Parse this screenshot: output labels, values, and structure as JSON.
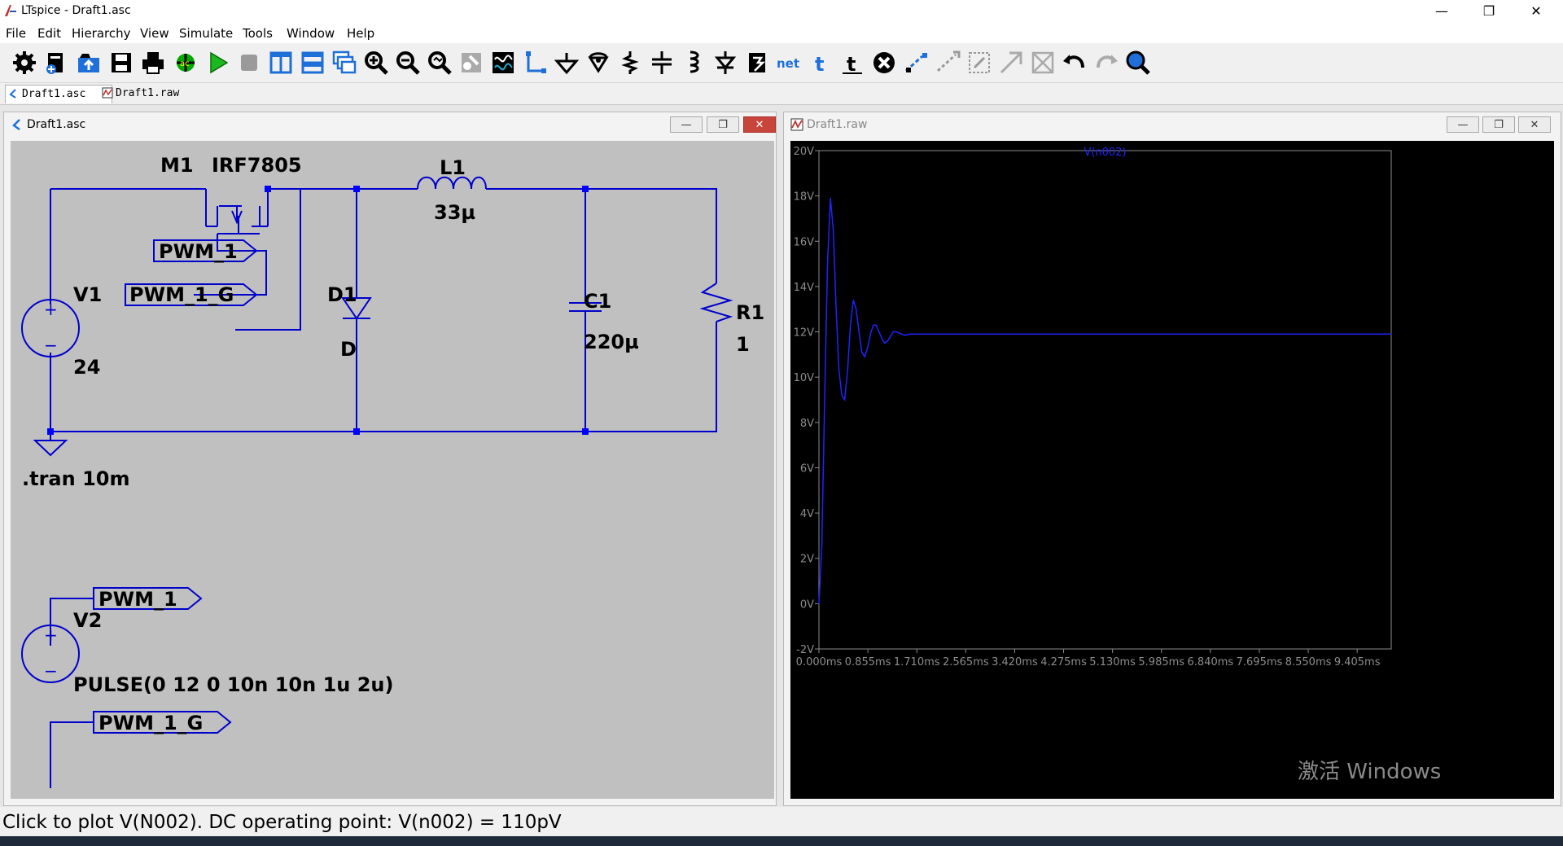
{
  "app": {
    "title": "LTspice - Draft1.asc",
    "window_controls": {
      "minimize": "—",
      "maximize": "❐",
      "close": "✕"
    }
  },
  "menu": [
    "File",
    "Edit",
    "Hierarchy",
    "View",
    "Simulate",
    "Tools",
    "Window",
    "Help"
  ],
  "toolbar": {
    "icons": [
      "settings-icon",
      "new-schematic-icon",
      "open-icon",
      "save-icon",
      "print-icon",
      "ac-analysis-icon",
      "run-icon",
      "halt-icon",
      "tile-vertical-icon",
      "tile-horizontal-icon",
      "cascade-icon",
      "zoom-in-icon",
      "zoom-out-icon",
      "zoom-fit-icon",
      "zoom-area-icon",
      "autoscale-icon",
      "wire-icon",
      "ground-icon",
      "label-net-icon",
      "resistor-icon",
      "capacitor-icon",
      "inductor-icon",
      "diode-icon",
      "component-icon",
      "spice-directive-icon",
      "text-icon",
      "move-icon",
      "delete-icon",
      "duplicate-icon",
      "drag-icon",
      "rotate-icon",
      "mirror-icon",
      "undo-icon",
      "redo-icon",
      "find-icon"
    ],
    "net_label": "net"
  },
  "tabs": [
    {
      "label": "Draft1.asc",
      "active": true
    },
    {
      "label": "Draft1.raw",
      "active": false
    }
  ],
  "schematic_window": {
    "title": "Draft1.asc",
    "labels": {
      "m1": "M1",
      "m1_model": "IRF7805",
      "l1": "L1",
      "l1_value": "33µ",
      "v1": "V1",
      "v1_value": "24",
      "d1": "D1",
      "d1_model": "D",
      "c1": "C1",
      "c1_value": "220µ",
      "r1": "R1",
      "r1_value": "1",
      "net_pwm1": "PWM_1",
      "net_pwm1g": "PWM_1_G",
      "tran": ".tran 10m",
      "v2": "V2",
      "v2_value": "PULSE(0 12 0 10n 10n 1u 2u)",
      "v2_net_top": "PWM_1",
      "v2_net_bottom": "PWM_1_G",
      "source_plus": "+",
      "source_minus": "−"
    }
  },
  "waveform_window": {
    "title": "Draft1.raw",
    "trace_name": "V(n002)",
    "trace_color": "#2222ff"
  },
  "chart_data": {
    "type": "line",
    "title": "",
    "series": [
      {
        "name": "V(n002)",
        "x": [
          0,
          0.05,
          0.1,
          0.15,
          0.2,
          0.25,
          0.3,
          0.35,
          0.4,
          0.45,
          0.5,
          0.55,
          0.6,
          0.65,
          0.7,
          0.75,
          0.8,
          0.85,
          0.9,
          0.95,
          1.0,
          1.05,
          1.1,
          1.15,
          1.2,
          1.25,
          1.3,
          1.35,
          1.4,
          1.45,
          1.5,
          1.6,
          1.7,
          1.8,
          1.9,
          2.0,
          2.1,
          2.2,
          2.4,
          2.6,
          3.0,
          4.0,
          5.0,
          6.0,
          7.0,
          8.0,
          9.0,
          10.0
        ],
        "y": [
          0.0,
          2.5,
          9.0,
          15.0,
          17.9,
          16.5,
          13.0,
          10.3,
          9.2,
          9.0,
          10.3,
          12.3,
          13.4,
          13.0,
          12.0,
          11.1,
          10.9,
          11.3,
          11.9,
          12.3,
          12.3,
          12.0,
          11.7,
          11.5,
          11.6,
          11.8,
          12.0,
          12.0,
          11.95,
          11.9,
          11.85,
          11.9,
          11.9,
          11.9,
          11.9,
          11.9,
          11.9,
          11.9,
          11.9,
          11.9,
          11.9,
          11.9,
          11.9,
          11.9,
          11.9,
          11.9,
          11.9,
          11.9
        ]
      }
    ],
    "x_ticks": [
      "0.000ms",
      "0.855ms",
      "1.710ms",
      "2.565ms",
      "3.420ms",
      "4.275ms",
      "5.130ms",
      "5.985ms",
      "6.840ms",
      "7.695ms",
      "8.550ms",
      "9.405ms"
    ],
    "y_ticks": [
      "20V",
      "18V",
      "16V",
      "14V",
      "12V",
      "10V",
      "8V",
      "6V",
      "4V",
      "2V",
      "0V",
      "-2V"
    ],
    "xlim": [
      0,
      10
    ],
    "ylim": [
      -2,
      20
    ],
    "grid": false,
    "legend": "top-center",
    "background": "#000000",
    "axis_color": "#8c8c8c"
  },
  "status_bar": {
    "text": "Click to plot V(N002).  DC operating point: V(n002) = 110pV"
  },
  "watermark": "激活 Windows",
  "colors": {
    "schematic_bg": "#c0c0c0",
    "wire": "#0000cc",
    "component": "#0000cc",
    "node": "#0000ff",
    "label_text": "#000000"
  }
}
